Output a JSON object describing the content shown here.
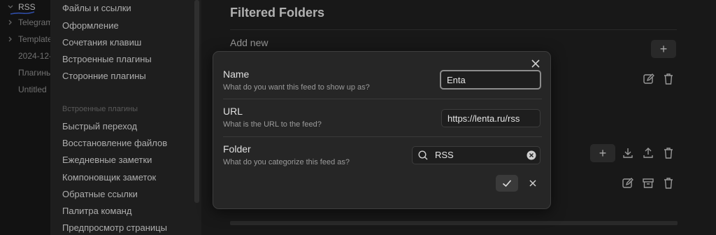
{
  "file_tree": {
    "items": [
      {
        "label": "RSS",
        "chevron": "chevron-down-icon",
        "active": true
      },
      {
        "label": "Telegram",
        "chevron": "chevron-right-icon"
      },
      {
        "label": "Templates",
        "chevron": "chevron-right-icon"
      },
      {
        "label": "2024-12-",
        "chevron": ""
      },
      {
        "label": "Плагины",
        "chevron": ""
      },
      {
        "label": "Untitled",
        "chevron": ""
      }
    ]
  },
  "settings_sidebar": {
    "top_items": [
      "Файлы и ссылки",
      "Оформление",
      "Сочетания клавиш",
      "Встроенные плагины",
      "Сторонние плагины"
    ],
    "section_heading": "Встроенные плагины",
    "plugin_items": [
      "Быстрый переход",
      "Восстановление файлов",
      "Ежедневные заметки",
      "Компоновщик заметок",
      "Обратные ссылки",
      "Палитра команд",
      "Предпросмотр страницы"
    ]
  },
  "main": {
    "title": "Filtered Folders",
    "add_new_label": "Add new",
    "add_button_label": "+",
    "folder_add_button_label": "+"
  },
  "modal": {
    "name": {
      "title": "Name",
      "description": "What do you want this feed to show up as?",
      "value": "Enta"
    },
    "url": {
      "title": "URL",
      "description": "What is the URL to the feed?",
      "value": "https://lenta.ru/rss"
    },
    "folder": {
      "title": "Folder",
      "description": "What do you categorize this feed as?",
      "value": "RSS"
    }
  },
  "colors": {
    "background": "#1e1e1e",
    "sidebar": "#252525",
    "modal": "#262626",
    "accent_underline": "#3a5fcd"
  }
}
